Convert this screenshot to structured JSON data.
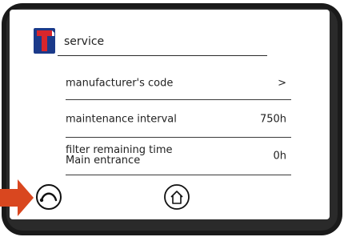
{
  "header": {
    "title": "service",
    "logo": "T-logo"
  },
  "rows": [
    {
      "label": "manufacturer's code",
      "value": ">"
    },
    {
      "label": "maintenance interval",
      "value": "750h"
    },
    {
      "label_line1": "filter remaining time",
      "label_line2": "Main entrance",
      "value": "0h"
    }
  ],
  "footer": {
    "back_icon": "back-arc-icon",
    "home_icon": "home-icon"
  },
  "colors": {
    "pointer": "#d9471f",
    "logo_blue": "#1b3a8a",
    "logo_red": "#d8262c"
  }
}
